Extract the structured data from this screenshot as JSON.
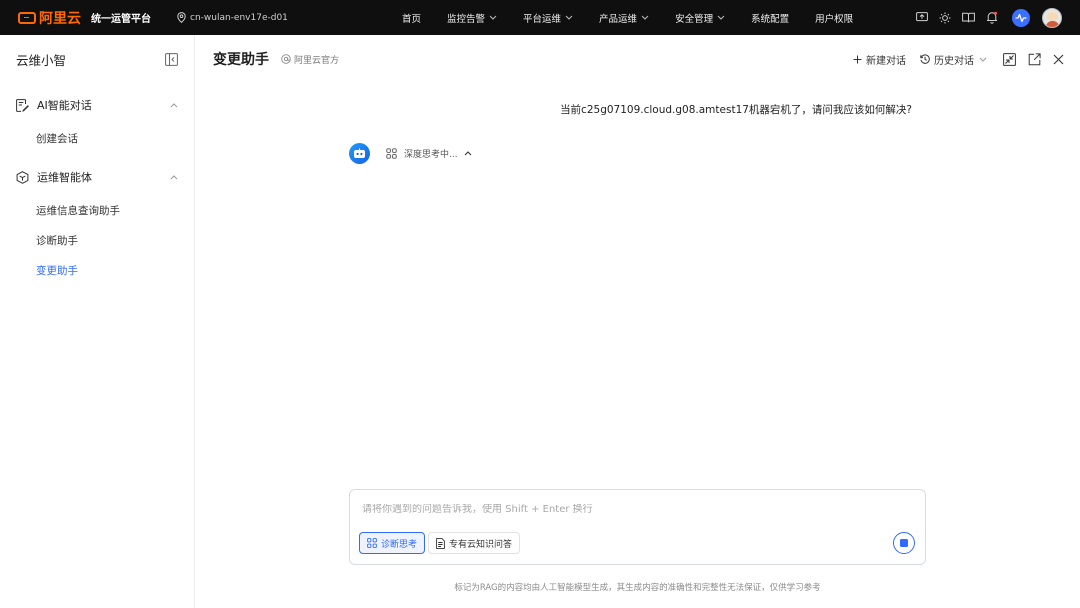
{
  "topnav": {
    "brand": "阿里云",
    "platform": "统一运管平台",
    "env": "cn-wulan-env17e-d01",
    "menu": [
      {
        "label": "首页",
        "has_dropdown": false
      },
      {
        "label": "监控告警",
        "has_dropdown": true
      },
      {
        "label": "平台运维",
        "has_dropdown": true
      },
      {
        "label": "产品运维",
        "has_dropdown": true
      },
      {
        "label": "安全管理",
        "has_dropdown": true
      },
      {
        "label": "系统配置",
        "has_dropdown": false
      },
      {
        "label": "用户权限",
        "has_dropdown": false
      }
    ],
    "icons": [
      "screen-share-icon",
      "sun-icon",
      "book-icon",
      "bell-icon",
      "ai-assistant-icon",
      "user-avatar"
    ]
  },
  "sidebar": {
    "title": "云维小智",
    "groups": [
      {
        "label": "AI智能对话",
        "icon": "chat-edit-icon",
        "expanded": true,
        "items": [
          {
            "label": "创建会话",
            "active": false
          }
        ]
      },
      {
        "label": "运维智能体",
        "icon": "agent-cube-icon",
        "expanded": true,
        "items": [
          {
            "label": "运维信息查询助手",
            "active": false
          },
          {
            "label": "诊断助手",
            "active": false
          },
          {
            "label": "变更助手",
            "active": true
          }
        ]
      }
    ]
  },
  "main": {
    "title": "变更助手",
    "official": "阿里云官方",
    "actions": {
      "new_chat": "新建对话",
      "history": "历史对话"
    },
    "user_message": "当前c25g07109.cloud.g08.amtest17机器宕机了，请问我应该如何解决?",
    "thinking": "深度思考中...",
    "input": {
      "placeholder": "请将你遇到的问题告诉我，使用 Shift + Enter 换行",
      "value": ""
    },
    "chips": {
      "diagnose": "诊断思考",
      "knowledge": "专有云知识问答"
    },
    "disclaimer": "标记为RAG的内容均由人工智能模型生成，其生成内容的准确性和完整性无法保证，仅供学习参考"
  },
  "colors": {
    "accent": "#2f6bff",
    "brand": "#ff6a00",
    "nav_bg": "#0f0f10"
  }
}
